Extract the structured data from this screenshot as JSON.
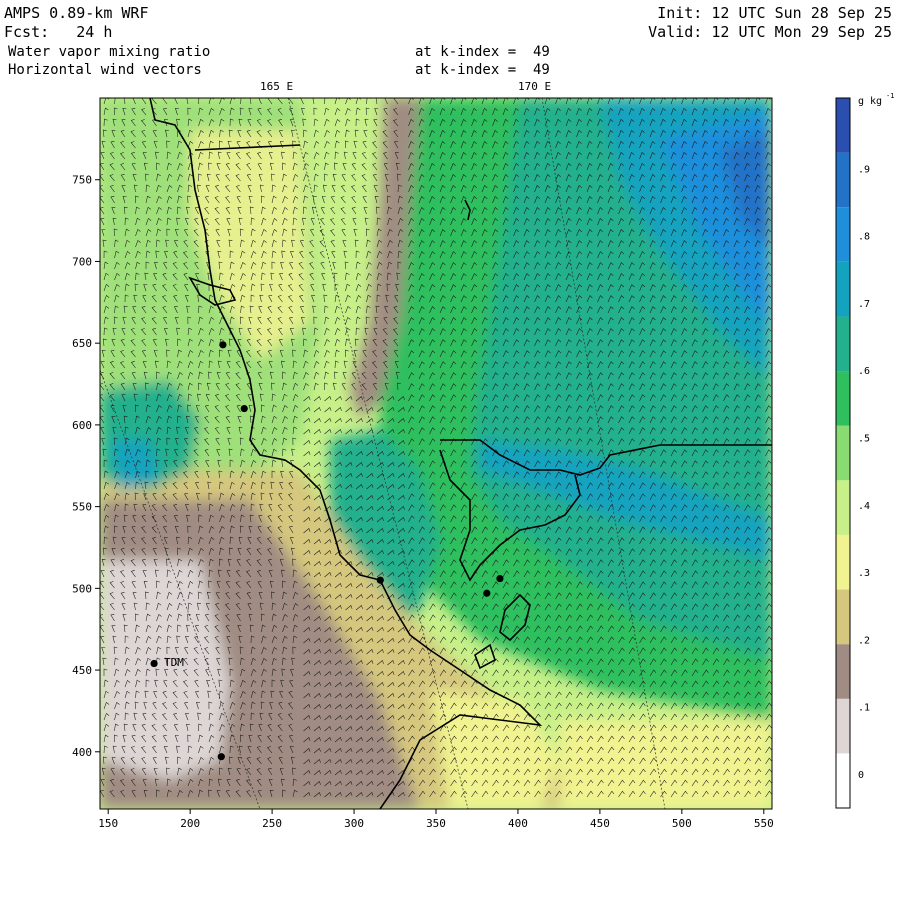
{
  "header": {
    "model": "AMPS 0.89-km WRF",
    "forecast": "Fcst:   24 h",
    "init": "Init: 12 UTC Sun 28 Sep 25",
    "valid": "Valid: 12 UTC Mon 29 Sep 25",
    "field1": "Water vapor mixing ratio",
    "field2": "Horizontal wind vectors",
    "level1": "at k-index =  49",
    "level2": "at k-index =  49"
  },
  "longitude_labels": [
    "165 E",
    "170 E"
  ],
  "x_ticks": [
    "150",
    "200",
    "250",
    "300",
    "350",
    "400",
    "450",
    "500",
    "550"
  ],
  "y_ticks": [
    "400",
    "450",
    "500",
    "550",
    "600",
    "650",
    "700",
    "750"
  ],
  "station_label": "TDM",
  "colorbar": {
    "unit_label": "g kg",
    "unit_exp": "-1",
    "labels": [
      "0",
      ".1",
      ".2",
      ".3",
      ".4",
      ".5",
      ".6",
      ".7",
      ".8",
      ".9"
    ],
    "colors": [
      "#ffffff",
      "#ddd6d4",
      "#a08c82",
      "#d6c77e",
      "#f0f38f",
      "#c7f089",
      "#89db72",
      "#2fbf5e",
      "#22b08d",
      "#14a3bf",
      "#1f8fdc",
      "#2272c8",
      "#2a4fb0"
    ]
  },
  "chart_data": {
    "type": "heatmap",
    "title": "Water vapor mixing ratio",
    "unit": "g kg-1",
    "x_range": [
      145,
      555
    ],
    "y_range": [
      365,
      800
    ],
    "levels": [
      0,
      0.05,
      0.1,
      0.15,
      0.2,
      0.25,
      0.3,
      0.35,
      0.4,
      0.45,
      0.5,
      0.55,
      0.6,
      0.65,
      0.7,
      0.75,
      0.8,
      0.85,
      0.9,
      0.95
    ],
    "stations": [
      {
        "x": 220,
        "y": 649
      },
      {
        "x": 233,
        "y": 610
      },
      {
        "x": 316,
        "y": 505
      },
      {
        "x": 381,
        "y": 497
      },
      {
        "x": 389,
        "y": 506
      },
      {
        "x": 178,
        "y": 454,
        "label": "TDM"
      },
      {
        "x": 219,
        "y": 397
      }
    ]
  }
}
